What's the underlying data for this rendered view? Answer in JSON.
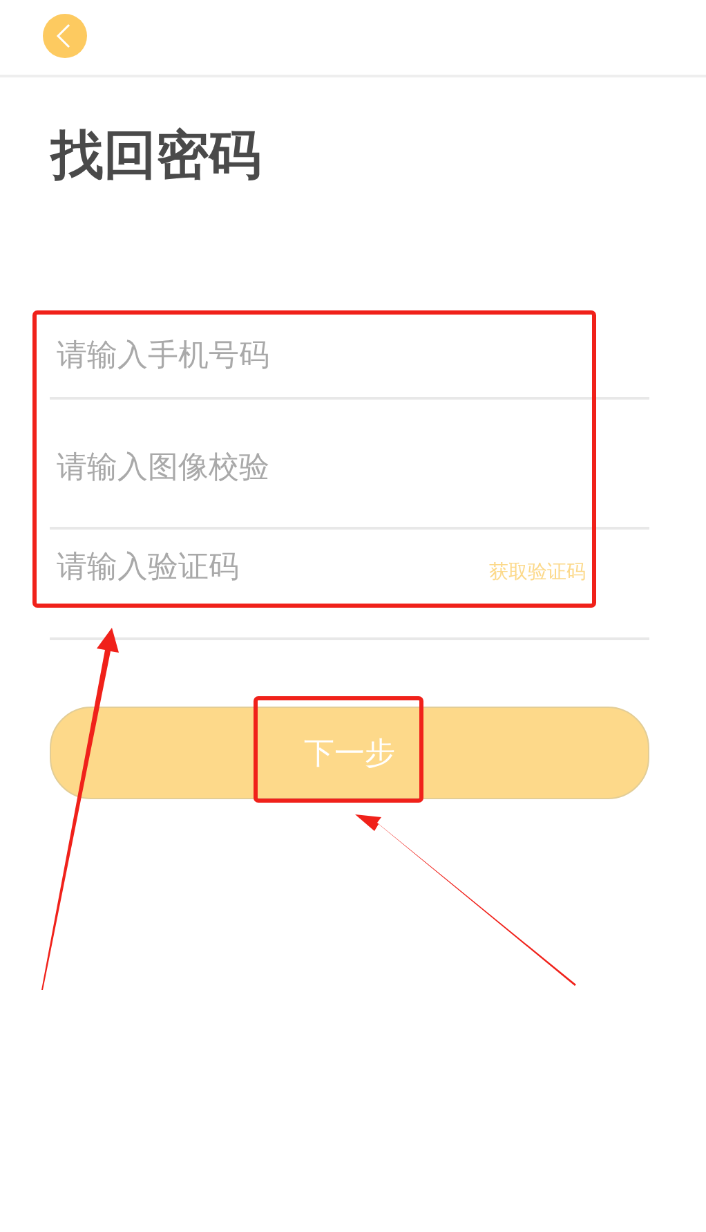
{
  "header": {
    "back": true
  },
  "title": "找回密码",
  "fields": [
    {
      "placeholder": "请输入手机号码"
    },
    {
      "placeholder": "请输入图像校验"
    },
    {
      "placeholder": "请输入验证码",
      "action": "获取验证码"
    }
  ],
  "submit": "下一步"
}
